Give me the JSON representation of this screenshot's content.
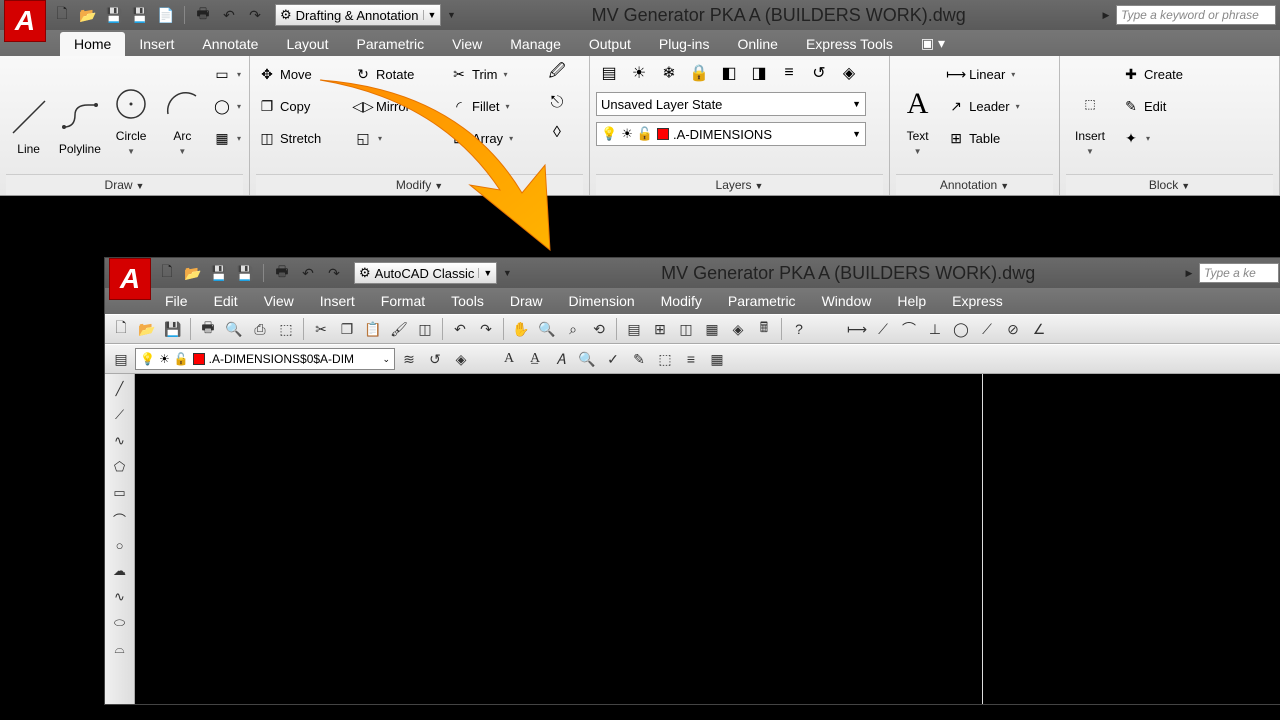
{
  "top": {
    "workspace": "Drafting & Annotation",
    "doc_title": "MV Generator PKA A (BUILDERS WORK).dwg",
    "search_placeholder": "Type a keyword or phrase",
    "tabs": [
      "Home",
      "Insert",
      "Annotate",
      "Layout",
      "Parametric",
      "View",
      "Manage",
      "Output",
      "Plug-ins",
      "Online",
      "Express Tools"
    ],
    "active_tab": "Home",
    "draw": {
      "line": "Line",
      "polyline": "Polyline",
      "circle": "Circle",
      "arc": "Arc",
      "panel": "Draw"
    },
    "modify": {
      "move": "Move",
      "copy": "Copy",
      "stretch": "Stretch",
      "rotate": "Rotate",
      "mirror": "Mirror",
      "scale": "Scale",
      "trim": "Trim",
      "fillet": "Fillet",
      "array": "Array",
      "panel": "Modify"
    },
    "layers": {
      "state": "Unsaved Layer State",
      "current": ".A-DIMENSIONS",
      "panel": "Layers"
    },
    "annotation": {
      "text": "Text",
      "linear": "Linear",
      "leader": "Leader",
      "table": "Table",
      "panel": "Annotation"
    },
    "block": {
      "insert": "Insert",
      "create": "Create",
      "edit": "Edit",
      "panel": "Block"
    }
  },
  "classic": {
    "workspace": "AutoCAD Classic",
    "doc_title": "MV Generator PKA A (BUILDERS WORK).dwg",
    "search_placeholder": "Type a ke",
    "menus": [
      "File",
      "Edit",
      "View",
      "Insert",
      "Format",
      "Tools",
      "Draw",
      "Dimension",
      "Modify",
      "Parametric",
      "Window",
      "Help",
      "Express"
    ],
    "layer_current": ".A-DIMENSIONS$0$A-DIM"
  }
}
